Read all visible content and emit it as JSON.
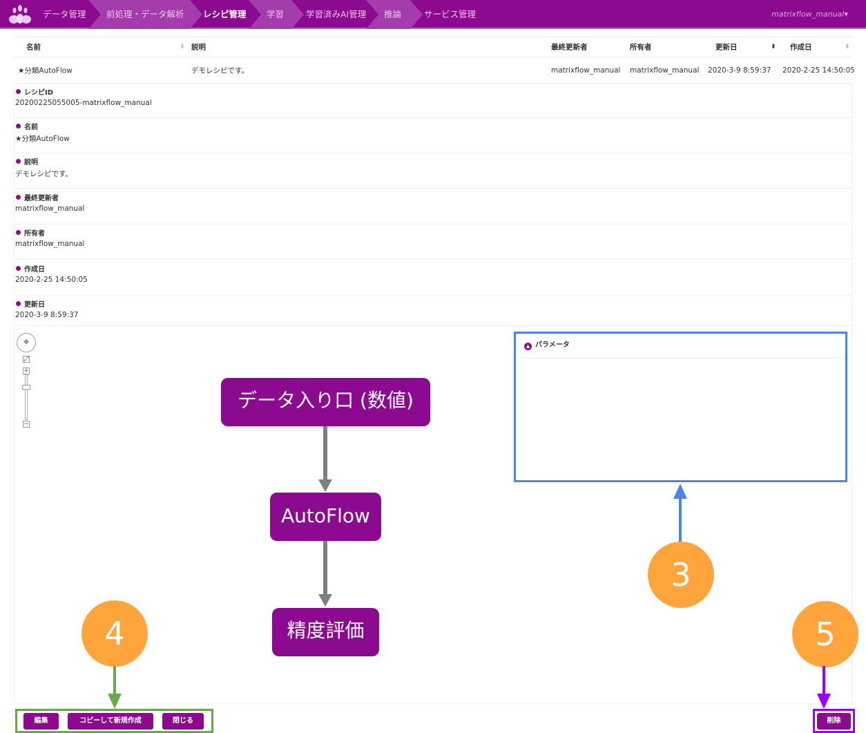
{
  "nav": {
    "items": [
      "データ管理",
      "前処理・データ解析",
      "レシピ管理",
      "学習",
      "学習済みAI管理",
      "推論",
      "サービス管理"
    ],
    "active": "レシピ管理",
    "user": "matrixflow_manual"
  },
  "table": {
    "headers": [
      "名前",
      "説明",
      "最終更新者",
      "所有者",
      "更新日",
      "作成日"
    ],
    "row": [
      "★分類AutoFlow",
      "デモレシピです。",
      "matrixflow_manual",
      "matrixflow_manual",
      "2020-3-9 8:59:37",
      "2020-2-25 14:50:05"
    ]
  },
  "details": [
    {
      "label": "レシピID",
      "value": "20200225055005-matrixflow_manual"
    },
    {
      "label": "名前",
      "value": "★分類AutoFlow"
    },
    {
      "label": "説明",
      "value": "デモレシピです。"
    },
    {
      "label": "最終更新者",
      "value": "matrixflow_manual"
    },
    {
      "label": "所有者",
      "value": "matrixflow_manual"
    },
    {
      "label": "作成日",
      "value": "2020-2-25 14:50:05"
    },
    {
      "label": "更新日",
      "value": "2020-3-9 8:59:37"
    }
  ],
  "graph": {
    "nodes": [
      "データ入り口 (数値)",
      "AutoFlow",
      "精度評価"
    ]
  },
  "params": {
    "title": "パラメータ"
  },
  "buttons": {
    "edit": "編集",
    "copy": "コピーして新規作成",
    "close": "閉じる",
    "delete": "削除"
  },
  "annotations": {
    "a3": "3",
    "a4": "4",
    "a5": "5"
  },
  "colors": {
    "brand": "#8b0a8f",
    "annotation": "#ffa53c",
    "blue": "#4a86e8",
    "green": "#6aa84f",
    "violet": "#9900ff"
  }
}
